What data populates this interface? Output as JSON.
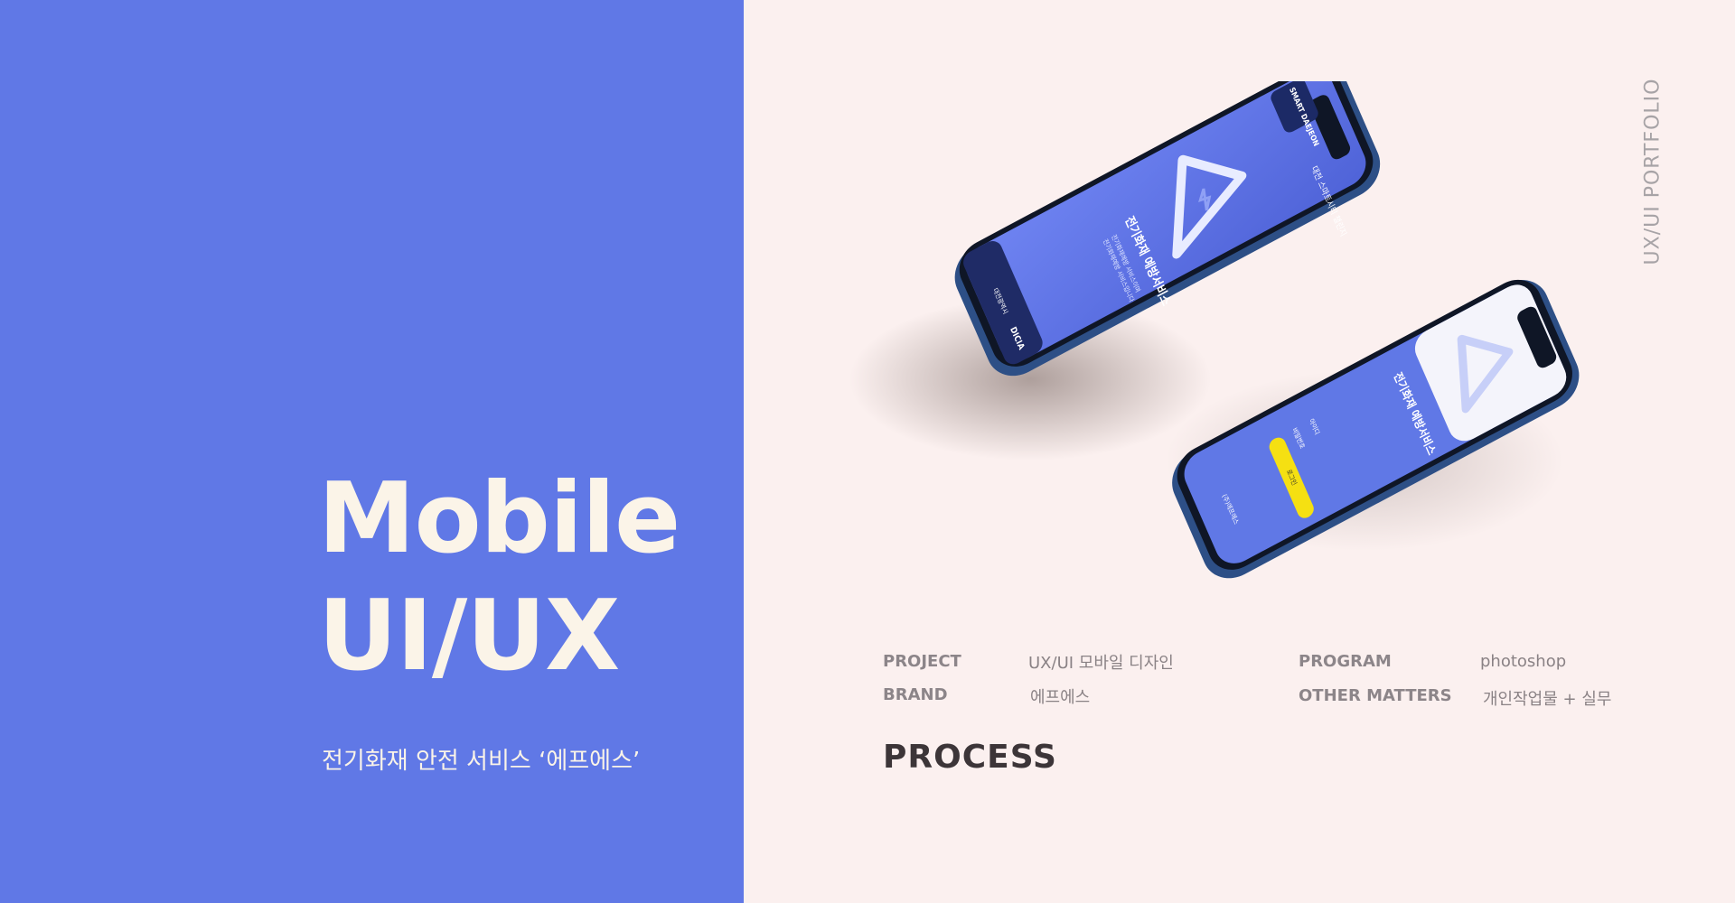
{
  "hero": {
    "line1": "Mobile",
    "line2": "UI/UX",
    "subtitle": "전기화재 안전 서비스 ‘에프에스’"
  },
  "side_label": "UX/UI PORTFOLIO",
  "info": {
    "project_label": "PROJECT",
    "project_value": "UX/UI 모바일 디자인",
    "brand_label": "BRAND",
    "brand_value": "에프에스",
    "program_label": "PROGRAM",
    "program_value": "photoshop",
    "other_label": "OTHER MATTERS",
    "other_value": "개인작업물 + 실무"
  },
  "process_title": "PROCESS",
  "phone_screen": {
    "brand_logo": "SMART DAEJEON",
    "app_tag": "대전 스마트시티 챌린지",
    "service_title": "전기화재 예방서비스",
    "service_desc_1": "전기화재예방 서비스이며",
    "service_desc_2": "전기화재예방 서비스입니다",
    "footer_1": "대전광역시",
    "footer_2": "DICIA",
    "login_id": "아이디",
    "login_pw": "비밀번호",
    "login_button": "로그인",
    "login_brand": "(주)에프에스"
  },
  "colors": {
    "left_panel": "#6078e6",
    "right_panel": "#fbf0ef",
    "accent_yellow": "#f5e012",
    "phone_frame": "#2d4f86"
  }
}
